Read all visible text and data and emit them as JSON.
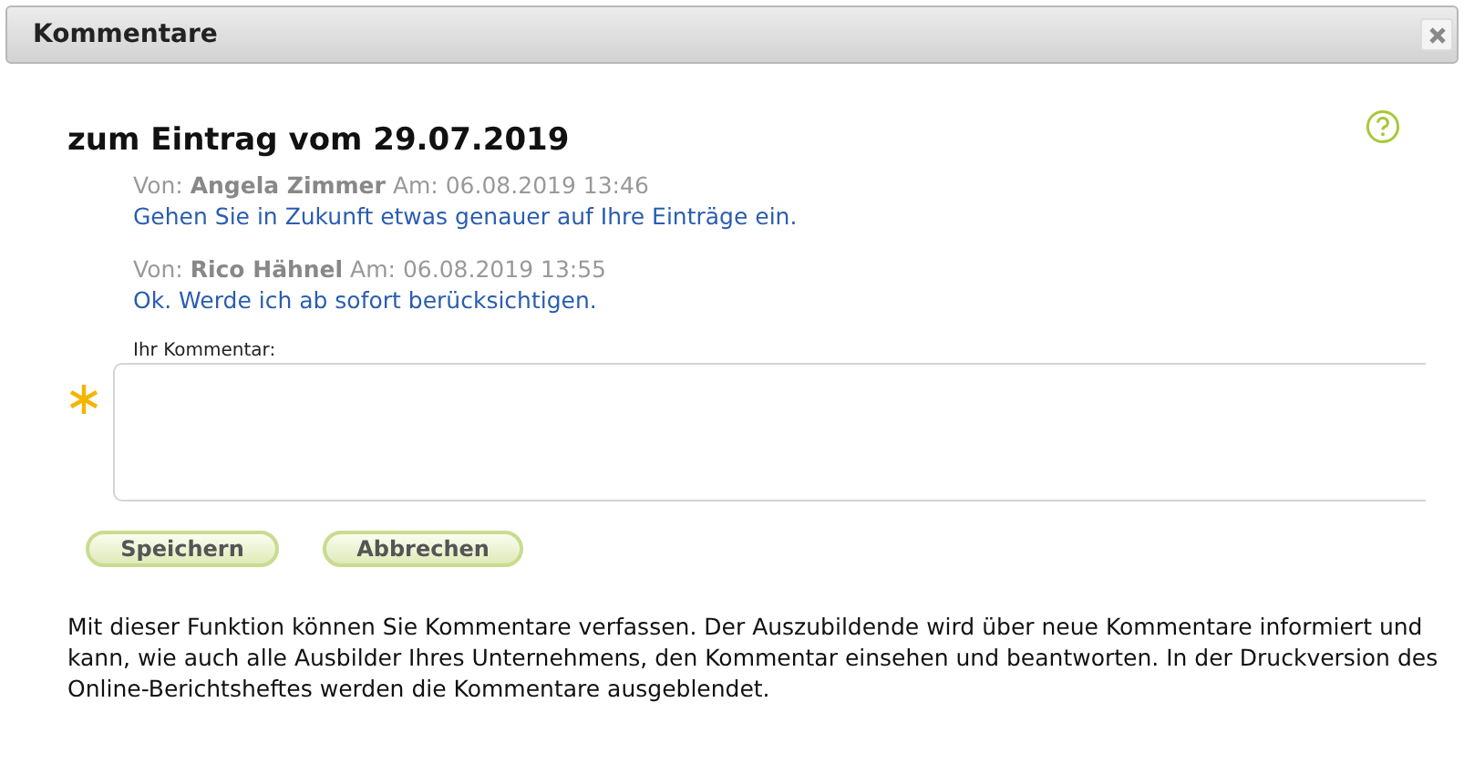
{
  "window": {
    "title": "Kommentare"
  },
  "heading": "zum Eintrag vom 29.07.2019",
  "comments": [
    {
      "meta": "Von: **Angela Zimmer** Am: 06.08.2019 13:46",
      "text": "Gehen Sie in Zukunft etwas genauer auf Ihre Einträge ein."
    },
    {
      "meta": "Von: **Rico Hähnel** Am: 06.08.2019 13:55",
      "text": "Ok. Werde ich ab sofort berücksichtigen."
    }
  ],
  "comment_field": {
    "label": "Ihr Kommentar:",
    "required": true
  },
  "buttons": [
    "Speichern",
    "Abbrechen"
  ],
  "info": "Mit dieser Funktion können Sie Kommentare verfassen. Der Auszubildende wird über neue Kommentare informiert und kann, wie auch alle Ausbilder Ihres Unternehmens, den Kommentar einsehen und beantworten. In der Druckversion des Online-Berichtsheftes werden die Kommentare ausgeblendet."
}
